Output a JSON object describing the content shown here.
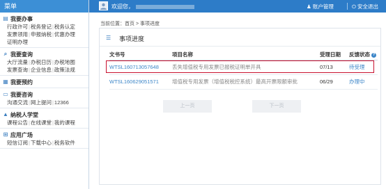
{
  "sidebar": {
    "title": "菜单",
    "sections": [
      {
        "title": "我要办事",
        "icon": "book-icon",
        "rows": [
          [
            "行政许可",
            "税务登记",
            "税务认定"
          ],
          [
            "发票领用",
            "申报纳税",
            "优惠办理"
          ],
          [
            "证明办理"
          ]
        ]
      },
      {
        "title": "我要查询",
        "icon": "search-icon",
        "rows": [
          [
            "大厅流量",
            "办税日历",
            "办税地图"
          ],
          [
            "发票查询",
            "企业信息",
            "政策法规"
          ]
        ]
      },
      {
        "title": "我要预约",
        "icon": "calendar-icon",
        "rows": []
      },
      {
        "title": "我要咨询",
        "icon": "chat-icon",
        "rows": [
          [
            "沟通交流",
            "网上提问",
            "12366"
          ]
        ]
      },
      {
        "title": "纳税人学堂",
        "icon": "graduation-icon",
        "rows": [
          [
            "课程公告",
            "在线课堂",
            "我的课程"
          ]
        ]
      },
      {
        "title": "应用广场",
        "icon": "grid-icon",
        "rows": [
          [
            "短信订阅",
            "下载中心",
            "税务软件"
          ]
        ]
      }
    ]
  },
  "topbar": {
    "welcome": "欢迎您，",
    "account": "账户管理",
    "security": "安全退出"
  },
  "breadcrumb": "当前位置：首页 > 事项进度",
  "panel": {
    "title": "事项进度",
    "columns": [
      "文书号",
      "项目名称",
      "受理日期",
      "反馈状态"
    ],
    "rows": [
      {
        "doc_no": "WTSL160713057648",
        "name": "丢失增值税专用发票已报税证明单开具",
        "date": "07/13",
        "status": "待受理"
      },
      {
        "doc_no": "WTSL160629051571",
        "name": "增值税专用发票（增值税税控系统）最高开票限额审批",
        "date": "06/29",
        "status": "办理中"
      }
    ],
    "prev": "上一页",
    "next": "下一页"
  },
  "colors": {
    "topbar": "#2d7cc8",
    "link": "#3c86c8",
    "highlight": "#c8102e"
  }
}
